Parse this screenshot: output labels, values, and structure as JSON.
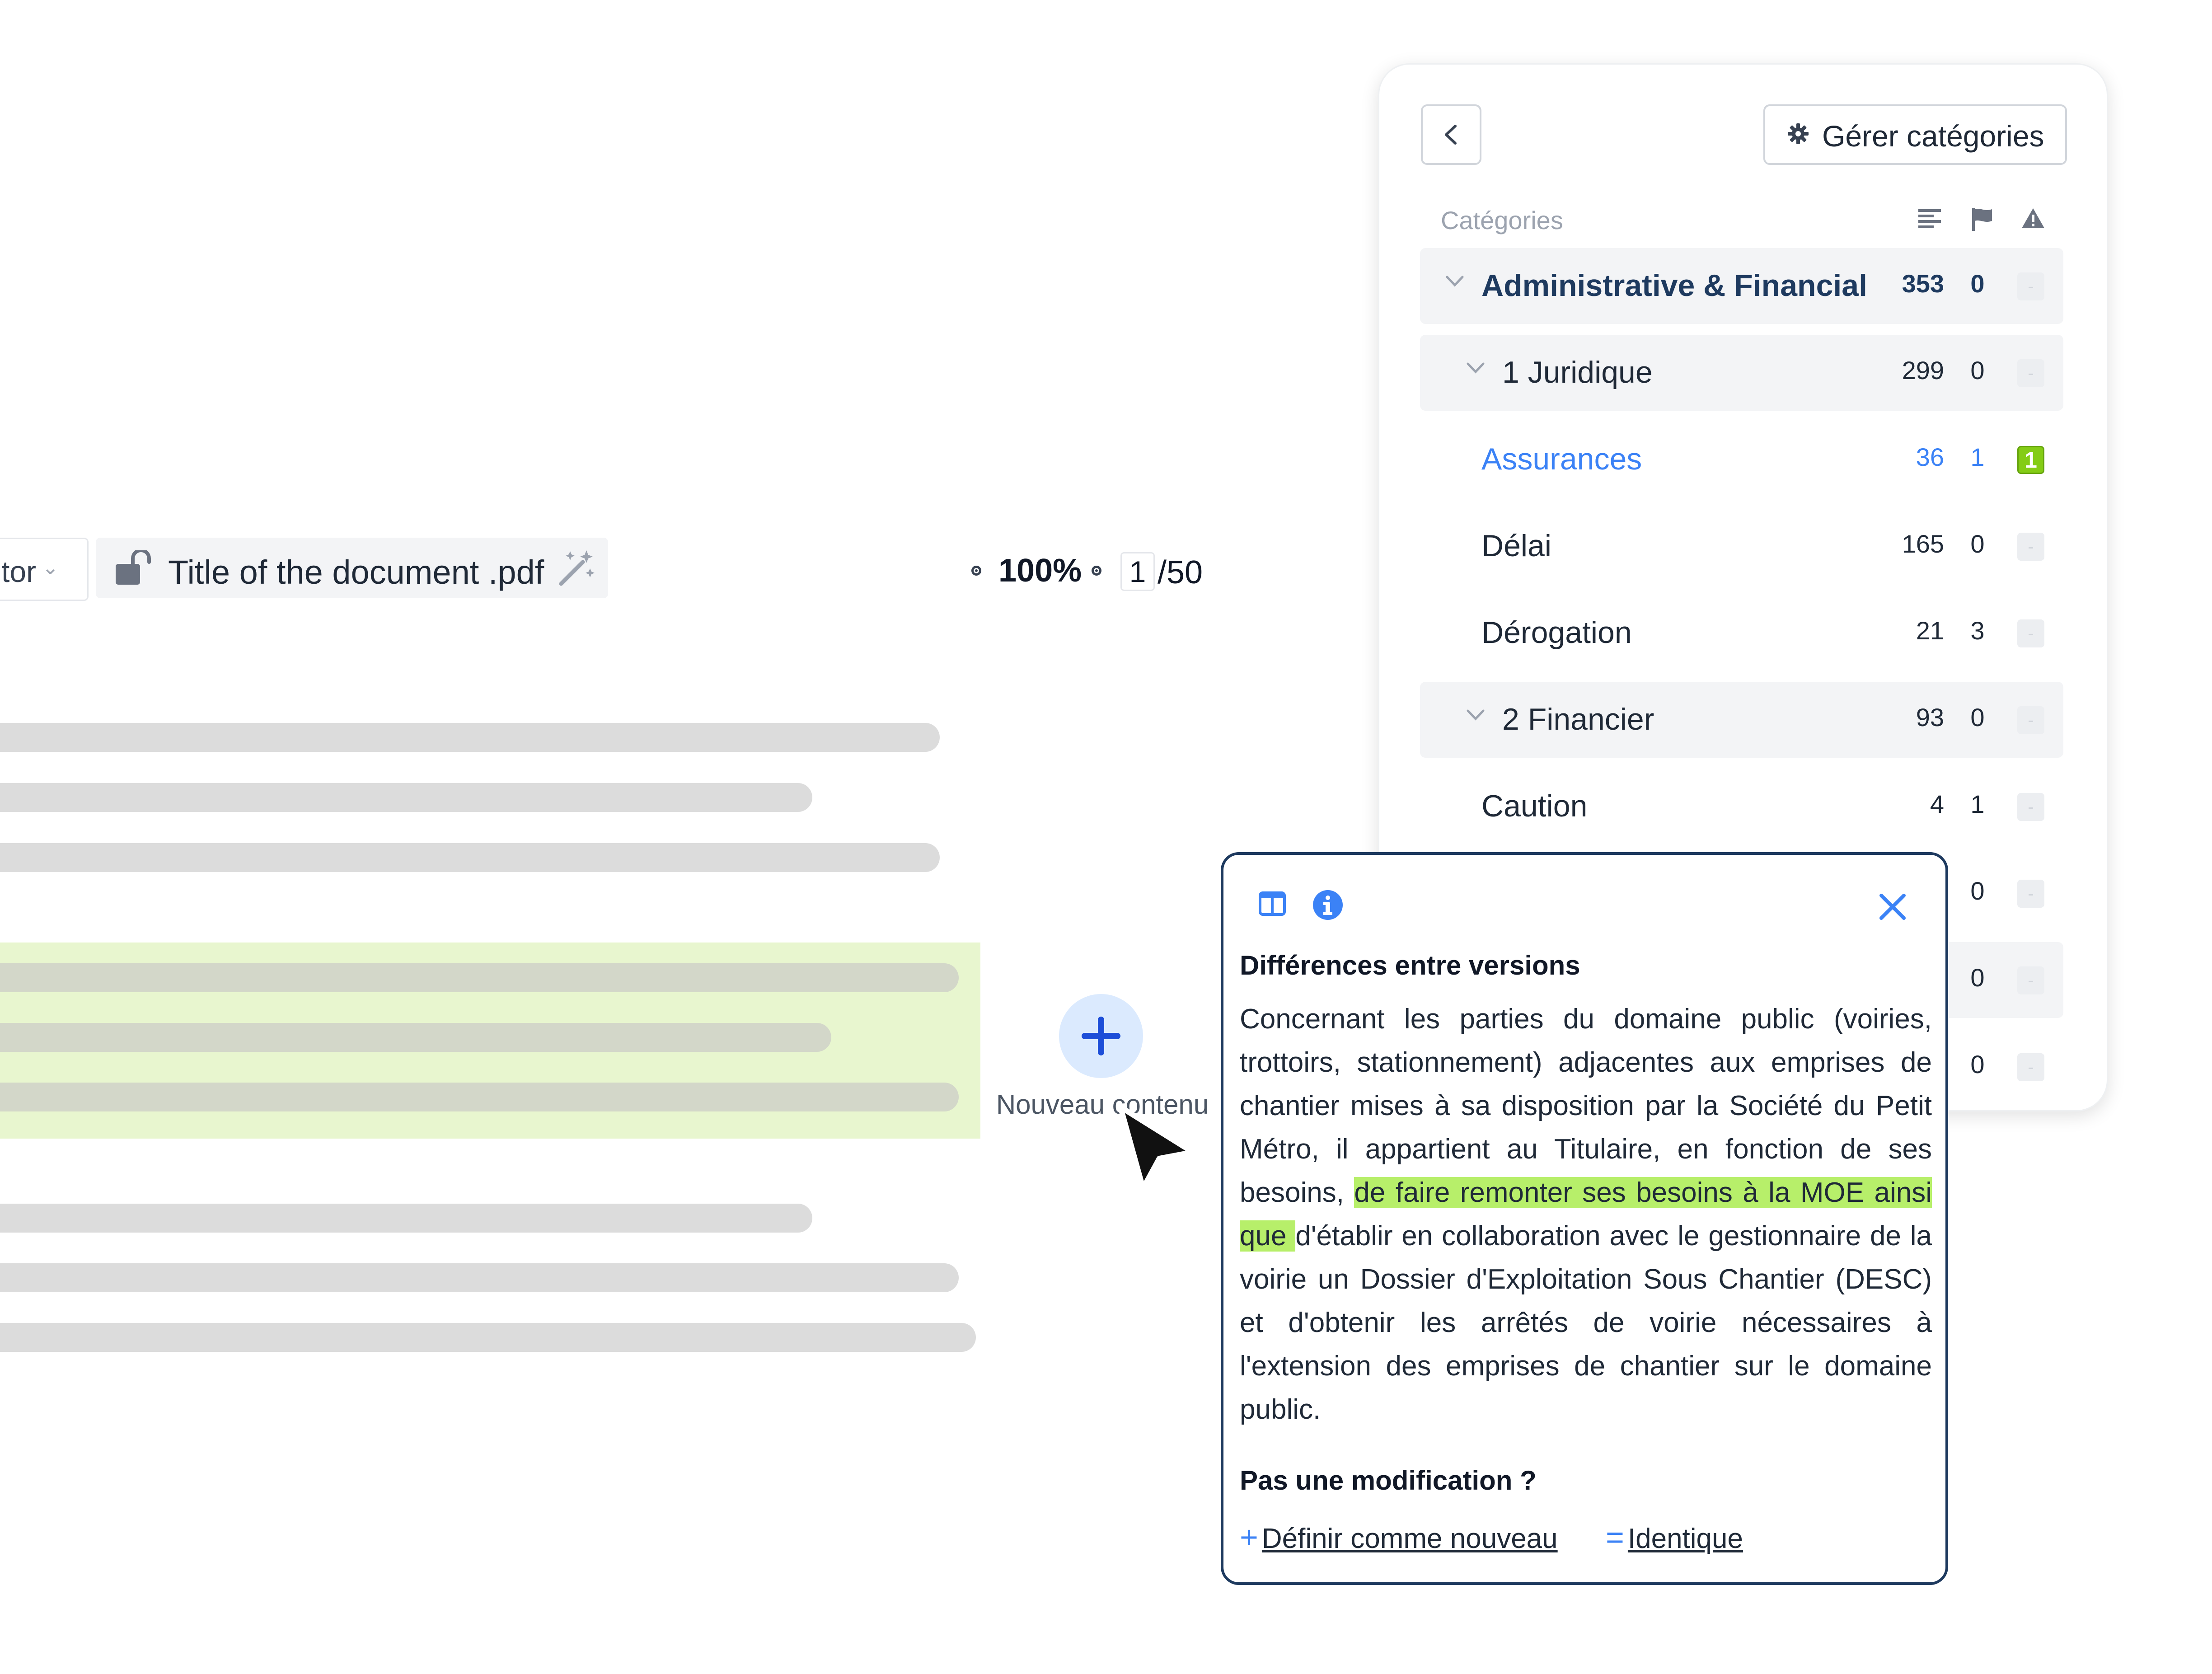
{
  "toolbar": {
    "selector_label": "tor",
    "document_title": "Title of the document .pdf",
    "zoom": "100%",
    "page_current": "1",
    "page_total": "/50"
  },
  "add_content": {
    "label": "Nouveau contenu"
  },
  "categories_panel": {
    "manage_label": "Gérer catégories",
    "heading": "Catégories",
    "header_icons": [
      "text-lines-icon",
      "flag-icon",
      "warning-icon"
    ],
    "rows": [
      {
        "name": "Administrative & Financial",
        "count": "353",
        "flags": "0",
        "warn": "-"
      },
      {
        "name": "1 Juridique",
        "count": "299",
        "flags": "0",
        "warn": "-"
      },
      {
        "name": "Assurances",
        "count": "36",
        "flags": "1",
        "warn": "1"
      },
      {
        "name": "Délai",
        "count": "165",
        "flags": "0",
        "warn": "-"
      },
      {
        "name": "Dérogation",
        "count": "21",
        "flags": "3",
        "warn": "-"
      },
      {
        "name": "2 Financier",
        "count": "93",
        "flags": "0",
        "warn": "-"
      },
      {
        "name": "Caution",
        "count": "4",
        "flags": "1",
        "warn": "-"
      },
      {
        "name": "",
        "count": "",
        "flags": "0",
        "warn": "-"
      },
      {
        "name": "",
        "count": "",
        "flags": "0",
        "warn": "-"
      },
      {
        "name": "",
        "count": "",
        "flags": "0",
        "warn": "-"
      }
    ]
  },
  "diff_popover": {
    "title": "Différences entre versions",
    "body_before": "Concernant les parties du domaine public (voiries, trottoirs, stationnement) adjacentes aux emprises de chantier mises à sa disposition par la Société du Petit Métro, il appartient au Titulaire, en fonction de ses besoins, ",
    "body_highlight": "de faire remonter ses besoins à la MOE ainsi que ",
    "body_after": "d'établir en collaboration avec le gestionnaire de la voirie un Dossier d'Exploitation Sous Chantier (DESC) et d'obtenir les arrêtés de voirie nécessaires à l'extension des emprises de chantier sur le domaine public.",
    "question": "Pas une modification ?",
    "action_new": "Définir comme nouveau",
    "action_identical": "Identique",
    "action_new_symbol": "+",
    "action_identical_symbol": "="
  },
  "colors": {
    "accent": "#3b82f6",
    "navy": "#1e3a5f",
    "highlight": "#b7ef6a",
    "highlight_block": "#e8f6cf",
    "warn_active": "#84cc16"
  }
}
